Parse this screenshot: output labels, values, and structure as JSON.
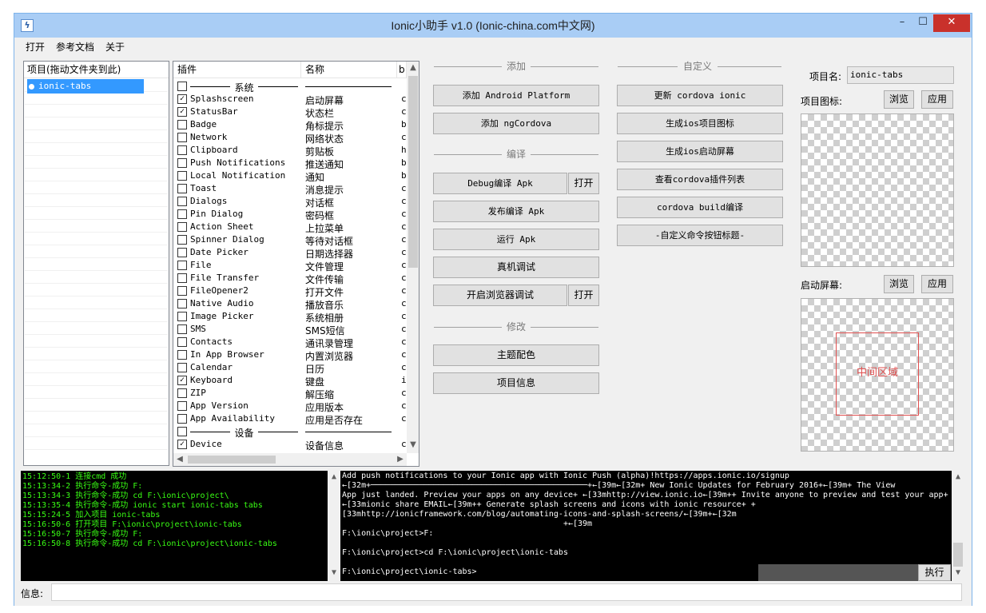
{
  "window": {
    "title": "Ionic小助手 v1.0 (Ionic-china.com中文网)",
    "icon": "lightning-icon",
    "min_label": "–",
    "max_label": "☐",
    "close_label": "✕"
  },
  "menu": [
    "打开",
    "参考文档",
    "关于"
  ],
  "projects": {
    "header": "项目(拖动文件夹到此)",
    "items": [
      "ionic-tabs"
    ]
  },
  "plugins": {
    "headers": [
      "插件",
      "名称",
      "b"
    ],
    "rows": [
      {
        "type": "group",
        "label": "系统",
        "checked": false
      },
      {
        "name": "Splashscreen",
        "cn": "启动屏幕",
        "x": "c",
        "checked": true
      },
      {
        "name": "StatusBar",
        "cn": "状态栏",
        "x": "c",
        "checked": true
      },
      {
        "name": "Badge",
        "cn": "角标提示",
        "x": "b",
        "checked": false
      },
      {
        "name": "Network",
        "cn": "网络状态",
        "x": "c",
        "checked": false
      },
      {
        "name": "Clipboard",
        "cn": "剪贴板",
        "x": "h",
        "checked": false
      },
      {
        "name": "Push Notifications",
        "cn": "推送通知",
        "x": "b",
        "checked": false
      },
      {
        "name": "Local Notification",
        "cn": "通知",
        "x": "b",
        "checked": false
      },
      {
        "name": "Toast",
        "cn": "消息提示",
        "x": "c",
        "checked": false
      },
      {
        "name": "Dialogs",
        "cn": "对话框",
        "x": "c",
        "checked": false
      },
      {
        "name": "Pin Dialog",
        "cn": "密码框",
        "x": "c",
        "checked": false
      },
      {
        "name": "Action Sheet",
        "cn": "上拉菜单",
        "x": "c",
        "checked": false
      },
      {
        "name": "Spinner Dialog",
        "cn": "等待对话框",
        "x": "c",
        "checked": false
      },
      {
        "name": "Date Picker",
        "cn": "日期选择器",
        "x": "c",
        "checked": false
      },
      {
        "name": "File",
        "cn": "文件管理",
        "x": "c",
        "checked": false
      },
      {
        "name": "File Transfer",
        "cn": "文件传输",
        "x": "c",
        "checked": false
      },
      {
        "name": "FileOpener2",
        "cn": "打开文件",
        "x": "c",
        "checked": false
      },
      {
        "name": "Native Audio",
        "cn": "播放音乐",
        "x": "c",
        "checked": false
      },
      {
        "name": "Image Picker",
        "cn": "系统相册",
        "x": "c",
        "checked": false
      },
      {
        "name": "SMS",
        "cn": "SMS短信",
        "x": "c",
        "checked": false
      },
      {
        "name": "Contacts",
        "cn": "通讯录管理",
        "x": "c",
        "checked": false
      },
      {
        "name": "In App Browser",
        "cn": "内置浏览器",
        "x": "c",
        "checked": false
      },
      {
        "name": "Calendar",
        "cn": "日历",
        "x": "c",
        "checked": false
      },
      {
        "name": "Keyboard",
        "cn": "键盘",
        "x": "i",
        "checked": true
      },
      {
        "name": "ZIP",
        "cn": "解压缩",
        "x": "c",
        "checked": false
      },
      {
        "name": "App Version",
        "cn": "应用版本",
        "x": "c",
        "checked": false
      },
      {
        "name": "App Availability",
        "cn": "应用是否存在",
        "x": "c",
        "checked": false
      },
      {
        "type": "group",
        "label": "设备",
        "checked": false
      },
      {
        "name": "Device",
        "cn": "设备信息",
        "x": "c",
        "checked": true
      }
    ]
  },
  "sections": {
    "add": "添加",
    "compile": "编译",
    "modify": "修改",
    "custom": "自定义"
  },
  "buttons": {
    "add_android": "添加 Android Platform",
    "add_ngcordova": "添加 ngCordova",
    "debug_apk": "Debug编译 Apk",
    "open1": "打开",
    "release_apk": "发布编译 Apk",
    "run_apk": "运行 Apk",
    "device_debug": "真机调试",
    "browser_debug": "开启浏览器调试",
    "open2": "打开",
    "theme": "主题配色",
    "project_info": "项目信息",
    "update_cordova": "更新 cordova ionic",
    "gen_icon": "生成ios项目图标",
    "gen_splash": "生成ios启动屏幕",
    "view_plugins": "查看cordova插件列表",
    "cordova_build": "cordova build编译",
    "custom_cmd": "-自定义命令按钮标题-"
  },
  "project": {
    "name_label": "项目名:",
    "name_value": "ionic-tabs",
    "icon_label": "项目图标:",
    "browse1": "浏览",
    "apply1": "应用",
    "splash_label": "启动屏幕:",
    "browse2": "浏览",
    "apply2": "应用",
    "center_label": "中间区域"
  },
  "log": [
    "15:12:50-1 连接cmd 成功",
    "15:13:34-2 执行命令-成功 F:",
    "15:13:34-3 执行命令-成功 cd F:\\ionic\\project\\",
    "15:13:35-4 执行命令-成功 ionic start ionic-tabs tabs",
    "15:15:24-5 加入项目 ionic-tabs",
    "15:16:50-6 打开项目 F:\\ionic\\project\\ionic-tabs",
    "15:16:50-7 执行命令-成功 F:",
    "15:16:50-8 执行命令-成功 cd F:\\ionic\\project\\ionic-tabs"
  ],
  "console": [
    "Add push notifications to your Ionic app with Ionic Push (alpha)!https://apps.ionic.io/signup",
    "←[32m+─────────────────────────────────────────────+←[39m←[32m+ New Ionic Updates for February 2016+←[39m+ The View",
    "App just landed. Preview your apps on any device+ ←[33mhttp://view.ionic.io←[39m++ Invite anyone to preview and test your app+",
    "←[33mionic share EMAIL←[39m++ Generate splash screens and icons with ionic resource+ +",
    "[33mhttp://ionicframework.com/blog/automating-icons-and-splash-screens/←[39m+←[32m",
    "                                              +←[39m",
    "F:\\ionic\\project>F:",
    "",
    "F:\\ionic\\project>cd F:\\ionic\\project\\ionic-tabs",
    "",
    "F:\\ionic\\project\\ionic-tabs>"
  ],
  "exec_label": "执行",
  "status_label": "信息:"
}
